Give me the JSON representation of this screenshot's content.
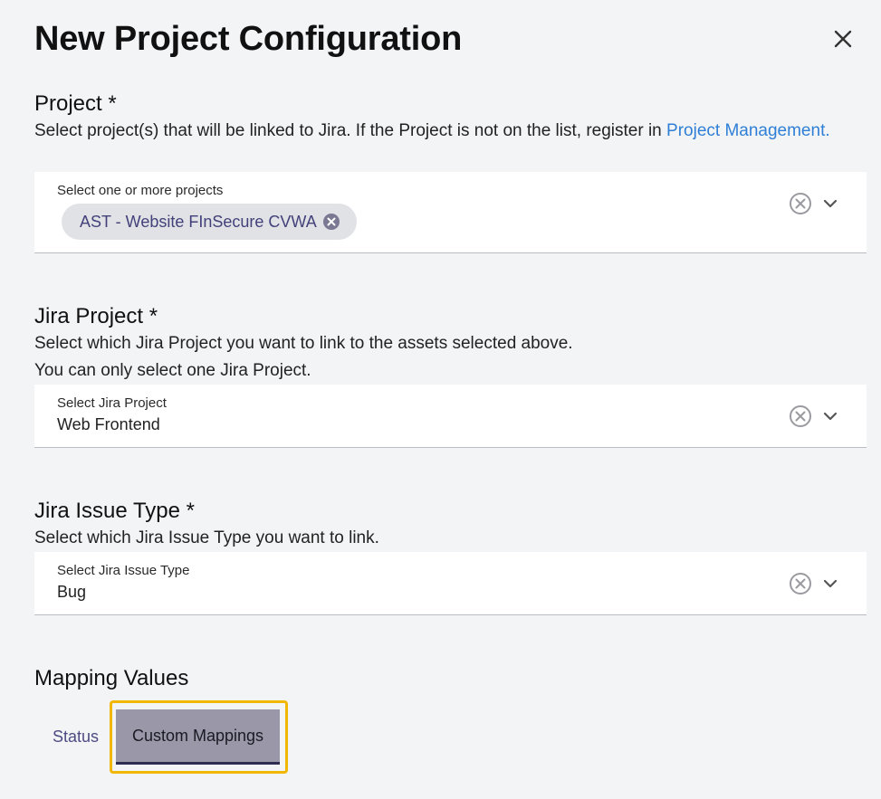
{
  "dialog": {
    "title": "New Project Configuration"
  },
  "project_section": {
    "title": "Project *",
    "description": "Select project(s) that will be linked to Jira. If the Project is not on the list, register in ",
    "link_text": "Project Management.",
    "field_label": "Select one or more projects",
    "chips": [
      {
        "label": "AST - Website FInSecure CVWA"
      }
    ]
  },
  "jira_project_section": {
    "title": "Jira Project *",
    "description_line1": "Select which Jira Project you want to link to the assets selected above.",
    "description_line2": "You can only select one Jira Project.",
    "field_label": "Select Jira Project",
    "field_value": "Web Frontend"
  },
  "jira_issue_type_section": {
    "title": "Jira Issue Type *",
    "description": "Select which Jira Issue Type you want to link.",
    "field_label": "Select Jira Issue Type",
    "field_value": "Bug"
  },
  "mapping_section": {
    "title": "Mapping Values",
    "tabs": [
      {
        "label": "Status",
        "selected": false
      },
      {
        "label": "Custom Mappings",
        "selected": true
      }
    ]
  },
  "icons": {
    "close": "close-icon",
    "clear": "clear-circle-icon",
    "chevron": "chevron-down-icon",
    "chip_delete": "chip-delete-icon"
  },
  "colors": {
    "link": "#2f7fd6",
    "chip_text": "#43417a",
    "tab_text": "#4d4b83",
    "highlight": "#f2b705",
    "selected_tab_bg": "#9a98a8"
  }
}
